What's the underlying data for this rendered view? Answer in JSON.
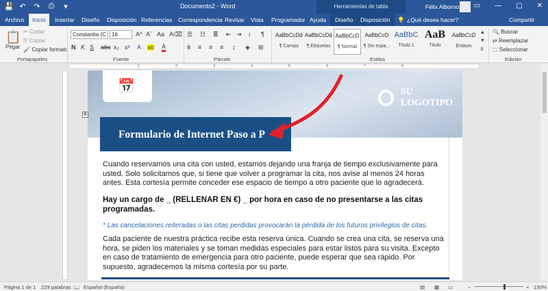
{
  "titlebar": {
    "doc_title": "Documento2 - Word",
    "context_title": "Herramientas de tabla",
    "user": "Félix Albornoz",
    "save_icon": "💾",
    "undo_icon": "↶",
    "redo_icon": "↷",
    "print_icon": "⎙",
    "more_icon": "▾",
    "minimize": "—",
    "maximize": "▢",
    "close": "✕",
    "ribbon_display": "▭"
  },
  "tabs": [
    "Archivo",
    "Inicio",
    "Insertar",
    "Diseño",
    "Disposición",
    "Referencias",
    "Correspondencia",
    "Revisar",
    "Vista",
    "Programador",
    "Ayuda",
    "Diseño",
    "Disposición"
  ],
  "tellme": "¿Qué desea hacer?",
  "share": "Compartir",
  "clipboard": {
    "paste": "Pegar",
    "cut": "Cortar",
    "copy": "Copiar",
    "format_painter": "Copiar formato",
    "group": "Portapapeles"
  },
  "font": {
    "name": "Constantia (C",
    "size": "16",
    "group": "Fuente",
    "bold": "N",
    "italic": "K",
    "underline": "S",
    "strike": "abc",
    "sub": "x₂",
    "sup": "x²",
    "grow": "A^",
    "shrink": "Aˇ",
    "case": "Aa",
    "clear": "A⌫",
    "effects": "A",
    "highlight": "ab",
    "color": "A"
  },
  "paragraph": {
    "group": "Párrafo",
    "pilcrow": "¶"
  },
  "styles": {
    "group": "Estilos",
    "items": [
      {
        "preview": "AaBbCcDdE",
        "name": "¶ Campo"
      },
      {
        "preview": "AaBbCcDdE",
        "name": "¶ Etiquetas"
      },
      {
        "preview": "AaBbCcD",
        "name": "¶ Normal"
      },
      {
        "preview": "AaBbCcD",
        "name": "¶ Sin espa..."
      },
      {
        "preview": "AaBbC",
        "name": "Título 1"
      },
      {
        "preview": "AaB",
        "name": "Título"
      },
      {
        "preview": "AaBbCcD",
        "name": "Énfasis"
      }
    ]
  },
  "editing": {
    "group": "Edición",
    "find": "Buscar",
    "replace": "Reemplazar",
    "select": "Seleccionar"
  },
  "document": {
    "logo": "SU LOGOTIPO",
    "title": "Formulario de Internet Paso a P",
    "para1": "Cuando reservamos una cita con usted, estamos dejando una franja de tiempo exclusivamente para usted. Solo solicitamos que, si tiene que volver a programar la cita, nos avise al menos 24 horas antes. Esta cortesía permite conceder ese espacio de tiempo a otro paciente que lo agradecerá.",
    "para2": "Hay un cargo de _ (RELLENAR EN €) _ por hora en caso de no presentarse a las citas programadas.",
    "para3": "* Las cancelaciones reiteradas o las citas perdidas provocarán la pérdida de los futuros privilegios de citas.",
    "para4": "Cada paciente de nuestra práctica recibe esta reserva única. Cuando se crea una cita, se reserva una hora, se piden los materiales y se toman medidas especiales para estar listos para su visita. Excepto en caso de tratamiento de emergencia para otro paciente, puede esperar que sea rápido. Por supuesto, agradecemos la misma cortesía por su parte."
  },
  "status": {
    "page": "Página 1 de 1",
    "words": "229 palabras",
    "lang": "Español (España)",
    "zoom": "130%",
    "minus": "−",
    "plus": "+"
  },
  "colors": {
    "brand": "#2b579a",
    "title_box": "#1a4f86",
    "arrow": "#e0202a",
    "note": "#2b6aa8"
  }
}
